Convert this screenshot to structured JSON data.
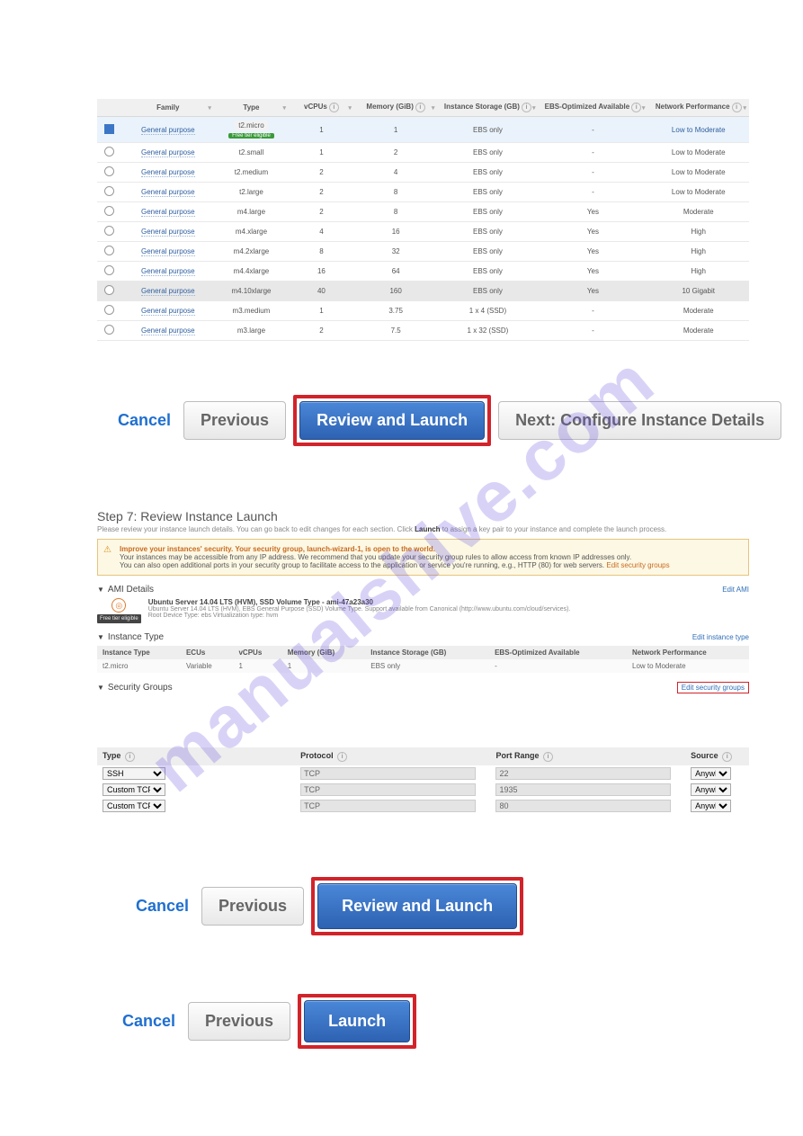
{
  "watermark": "manualshive.com",
  "instanceTable": {
    "headers": [
      "Family",
      "Type",
      "vCPUs",
      "Memory (GiB)",
      "Instance Storage (GB)",
      "EBS-Optimized Available",
      "Network Performance"
    ],
    "rows": [
      {
        "sel": true,
        "family": "General purpose",
        "type": "t2.micro",
        "free": "Free tier eligible",
        "vcpu": "1",
        "mem": "1",
        "storage": "EBS only",
        "ebs": "-",
        "net": "Low to Moderate",
        "netLink": true
      },
      {
        "sel": false,
        "family": "General purpose",
        "type": "t2.small",
        "vcpu": "1",
        "mem": "2",
        "storage": "EBS only",
        "ebs": "-",
        "net": "Low to Moderate"
      },
      {
        "sel": false,
        "family": "General purpose",
        "type": "t2.medium",
        "vcpu": "2",
        "mem": "4",
        "storage": "EBS only",
        "ebs": "-",
        "net": "Low to Moderate"
      },
      {
        "sel": false,
        "family": "General purpose",
        "type": "t2.large",
        "vcpu": "2",
        "mem": "8",
        "storage": "EBS only",
        "ebs": "-",
        "net": "Low to Moderate"
      },
      {
        "sel": false,
        "family": "General purpose",
        "type": "m4.large",
        "vcpu": "2",
        "mem": "8",
        "storage": "EBS only",
        "ebs": "Yes",
        "net": "Moderate"
      },
      {
        "sel": false,
        "family": "General purpose",
        "type": "m4.xlarge",
        "vcpu": "4",
        "mem": "16",
        "storage": "EBS only",
        "ebs": "Yes",
        "net": "High"
      },
      {
        "sel": false,
        "family": "General purpose",
        "type": "m4.2xlarge",
        "vcpu": "8",
        "mem": "32",
        "storage": "EBS only",
        "ebs": "Yes",
        "net": "High"
      },
      {
        "sel": false,
        "family": "General purpose",
        "type": "m4.4xlarge",
        "vcpu": "16",
        "mem": "64",
        "storage": "EBS only",
        "ebs": "Yes",
        "net": "High"
      },
      {
        "sel": false,
        "hl": true,
        "family": "General purpose",
        "type": "m4.10xlarge",
        "vcpu": "40",
        "mem": "160",
        "storage": "EBS only",
        "ebs": "Yes",
        "net": "10 Gigabit"
      },
      {
        "sel": false,
        "family": "General purpose",
        "type": "m3.medium",
        "vcpu": "1",
        "mem": "3.75",
        "storage": "1 x 4 (SSD)",
        "ebs": "-",
        "net": "Moderate"
      },
      {
        "sel": false,
        "family": "General purpose",
        "type": "m3.large",
        "vcpu": "2",
        "mem": "7.5",
        "storage": "1 x 32 (SSD)",
        "ebs": "-",
        "net": "Moderate"
      }
    ]
  },
  "buttons": {
    "cancel": "Cancel",
    "previous": "Previous",
    "reviewLaunch": "Review and Launch",
    "nextConfigure": "Next: Configure Instance Details",
    "launch": "Launch"
  },
  "review": {
    "title": "Step 7: Review Instance Launch",
    "sub1": "Please review your instance launch details. You can go back to edit changes for each section. Click ",
    "subBold": "Launch",
    "sub2": " to assign a key pair to your instance and complete the launch process.",
    "alertHead": "Improve your instances' security. Your security group, launch-wizard-1, is open to the world.",
    "alertLine1": "Your instances may be accessible from any IP address. We recommend that you update your security group rules to allow access from known IP addresses only.",
    "alertLine2": "You can also open additional ports in your security group to facilitate access to the application or service you're running, e.g., HTTP (80) for web servers. ",
    "alertLink": "Edit security groups",
    "amiSection": "AMI Details",
    "editAmi": "Edit AMI",
    "amiBadge": "Free tier eligible",
    "amiTitle": "Ubuntu Server 14.04 LTS (HVM), SSD Volume Type - ami-47a23a30",
    "amiSub": "Ubuntu Server 14.04 LTS (HVM), EBS General Purpose (SSD) Volume Type. Support available from Canonical (http://www.ubuntu.com/cloud/services).",
    "amiMeta": "Root Device Type: ebs    Virtualization type: hvm",
    "instanceTypeSection": "Instance Type",
    "editInstanceType": "Edit instance type",
    "secGroupsSection": "Security Groups",
    "editSecGroups": "Edit security groups",
    "miniHeaders": [
      "Instance Type",
      "ECUs",
      "vCPUs",
      "Memory (GiB)",
      "Instance Storage (GB)",
      "EBS-Optimized Available",
      "Network Performance"
    ],
    "miniRow": [
      "t2.micro",
      "Variable",
      "1",
      "1",
      "EBS only",
      "-",
      "Low to Moderate"
    ]
  },
  "sgTable": {
    "headers": [
      "Type",
      "Protocol",
      "Port Range",
      "Source"
    ],
    "rows": [
      {
        "type": "SSH",
        "proto": "TCP",
        "port": "22",
        "src": "Anywhere"
      },
      {
        "type": "Custom TCP Rule",
        "proto": "TCP",
        "port": "1935",
        "src": "Anywhere"
      },
      {
        "type": "Custom TCP Rule",
        "proto": "TCP",
        "port": "80",
        "src": "Anywhere"
      }
    ]
  }
}
